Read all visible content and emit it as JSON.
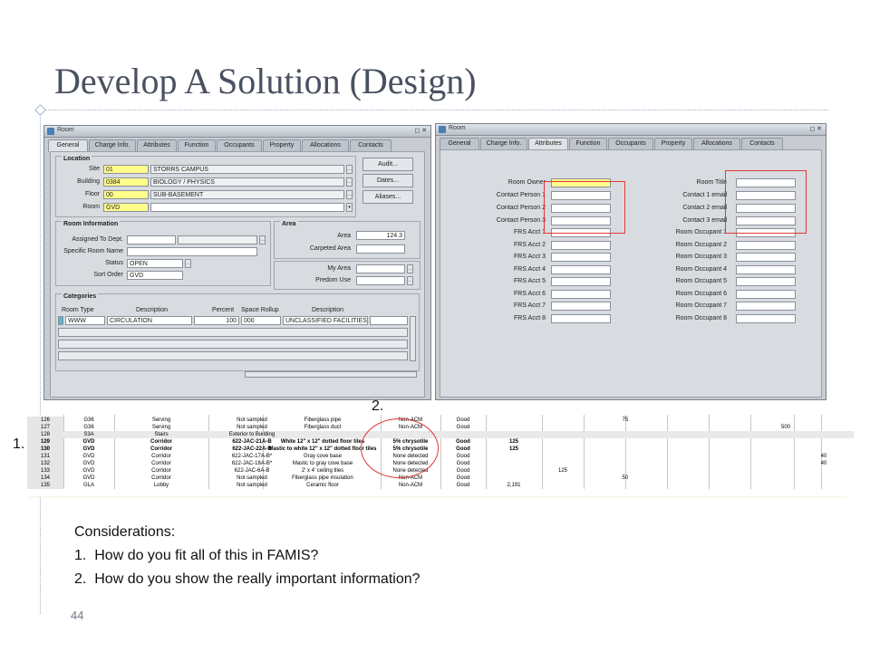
{
  "slide": {
    "title": "Develop A Solution (Design)",
    "page_number": "44",
    "considerations_heading": "Considerations:",
    "considerations": [
      {
        "num": "1.",
        "text": "How do you fit all of this in FAMIS?"
      },
      {
        "num": "2.",
        "text": "How do you show the really important information?"
      }
    ],
    "callout_1": "1.",
    "callout_2": "2."
  },
  "window_left": {
    "title": "Room",
    "tabs": [
      "General",
      "Charge Info.",
      "Attributes",
      "Function",
      "Occupants",
      "Property",
      "Allocations",
      "Contacts"
    ],
    "active_tab": "General",
    "location": {
      "heading": "Location",
      "site_label": "Site",
      "site_code": "01",
      "site_name": "STORRS CAMPUS",
      "building_label": "Building",
      "building_code": "0384",
      "building_name": "BIOLOGY / PHYSICS",
      "floor_label": "Floor",
      "floor_code": "00",
      "floor_name": "SUB-BASEMENT",
      "room_label": "Room",
      "room_code": "GVD"
    },
    "buttons": [
      "Audit...",
      "Dates...",
      "Aliases..."
    ],
    "room_info": {
      "heading": "Room Information",
      "assigned_label": "Assigned To Dept.",
      "specific_label": "Specific Room Name",
      "status_label": "Status",
      "status_value": "OPEN",
      "sort_label": "Sort Order",
      "sort_value": "GVD"
    },
    "area": {
      "heading": "Area",
      "area_label": "Area",
      "area_value": "124.3",
      "carpeted_label": "Carpeted Area",
      "my_area_label": "My Area",
      "predom_label": "Predom Use"
    },
    "categories": {
      "heading": "Categories",
      "headers": [
        "Room Type",
        "Description",
        "Percent",
        "Space Rollup",
        "Description"
      ],
      "row": [
        "WWW",
        "CIRCULATION",
        "100",
        "000",
        "UNCLASSIFIED FACILITIES"
      ]
    }
  },
  "window_right": {
    "title": "Room",
    "tabs": [
      "General",
      "Charge Info.",
      "Attributes",
      "Function",
      "Occupants",
      "Property",
      "Allocations",
      "Contacts"
    ],
    "active_tab": "Attributes",
    "left_labels": [
      "Room Owner",
      "Contact Person 1",
      "Contact Person 2",
      "Contact Person 3",
      "FRS Acct 1",
      "FRS Acct 2",
      "FRS Acct 3",
      "FRS Acct 4",
      "FRS Acct 5",
      "FRS Acct 6",
      "FRS Acct 7",
      "FRS Acct 8"
    ],
    "right_labels": [
      "Room Title",
      "Contact 1 email",
      "Contact 2 email",
      "Contact 3 email",
      "Room Occupant 1",
      "Room Occupant 2",
      "Room Occupant 3",
      "Room Occupant 4",
      "Room Occupant 5",
      "Room Occupant 6",
      "Room Occupant 7",
      "Room Occupant 8"
    ]
  },
  "sheet": {
    "rows": [
      {
        "n": "126",
        "a": "G36",
        "b": "Serving",
        "c": "Not sampled",
        "d": "Fiberglass pipe",
        "e": "Non-ACM",
        "f": "Good",
        "g": "",
        "h": "",
        "i": "75",
        "j": "",
        "k": "",
        "bold": false
      },
      {
        "n": "127",
        "a": "G36",
        "b": "Serving",
        "c": "Not sampled",
        "d": "Fiberglass duct",
        "e": "Non-ACM",
        "f": "Good",
        "g": "",
        "h": "",
        "i": "",
        "j": "500",
        "k": "",
        "bold": false
      },
      {
        "n": "128",
        "a": "S3A",
        "b": "Stairs",
        "c": "Exterior to Building",
        "d": "",
        "e": "",
        "f": "",
        "g": "",
        "h": "",
        "i": "",
        "j": "",
        "k": "",
        "bold": false
      },
      {
        "n": "129",
        "a": "GVD",
        "b": "Corridor",
        "c": "622-JAC-21A-B",
        "d": "White 12\" x 12\" dotted floor tiles",
        "e": "5% chrysotile",
        "f": "Good",
        "g": "125",
        "h": "",
        "i": "",
        "j": "",
        "k": "",
        "bold": true
      },
      {
        "n": "130",
        "a": "GVD",
        "b": "Corridor",
        "c": "622-JAC-22A-B",
        "d": "Mastic to white 12\" x 12\" dotted floor tiles",
        "e": "5% chrysotile",
        "f": "Good",
        "g": "125",
        "h": "",
        "i": "",
        "j": "",
        "k": "",
        "bold": true
      },
      {
        "n": "131",
        "a": "GVD",
        "b": "Corridor",
        "c": "622-JAC-17A-B*",
        "d": "Gray cove base",
        "e": "None detected",
        "f": "Good",
        "g": "",
        "h": "",
        "i": "",
        "j": "",
        "k": "40",
        "bold": false
      },
      {
        "n": "132",
        "a": "GVD",
        "b": "Corridor",
        "c": "622-JAC-18A-B*",
        "d": "Mastic to gray cove base",
        "e": "None detected",
        "f": "Good",
        "g": "",
        "h": "",
        "i": "",
        "j": "",
        "k": "40",
        "bold": false
      },
      {
        "n": "133",
        "a": "GVD",
        "b": "Corridor",
        "c": "622-JAC-6A-B",
        "d": "2' x 4' ceiling tiles",
        "e": "None detected",
        "f": "Good",
        "g": "",
        "h": "125",
        "i": "",
        "j": "",
        "k": "",
        "bold": false
      },
      {
        "n": "134",
        "a": "GVD",
        "b": "Corridor",
        "c": "Not sampled",
        "d": "Fiberglass pipe insulation",
        "e": "Non-ACM",
        "f": "Good",
        "g": "",
        "h": "",
        "i": "50",
        "j": "",
        "k": "",
        "bold": false
      },
      {
        "n": "135",
        "a": "GLA",
        "b": "Lobby",
        "c": "Not sampled",
        "d": "Ceramic floor",
        "e": "Non-ACM",
        "f": "Good",
        "g": "2,191",
        "h": "",
        "i": "",
        "j": "",
        "k": "",
        "bold": false
      }
    ]
  },
  "colors": {
    "title": "#4a5160",
    "highlight_red": "#e0383a",
    "required_field": "#fffd8a"
  }
}
